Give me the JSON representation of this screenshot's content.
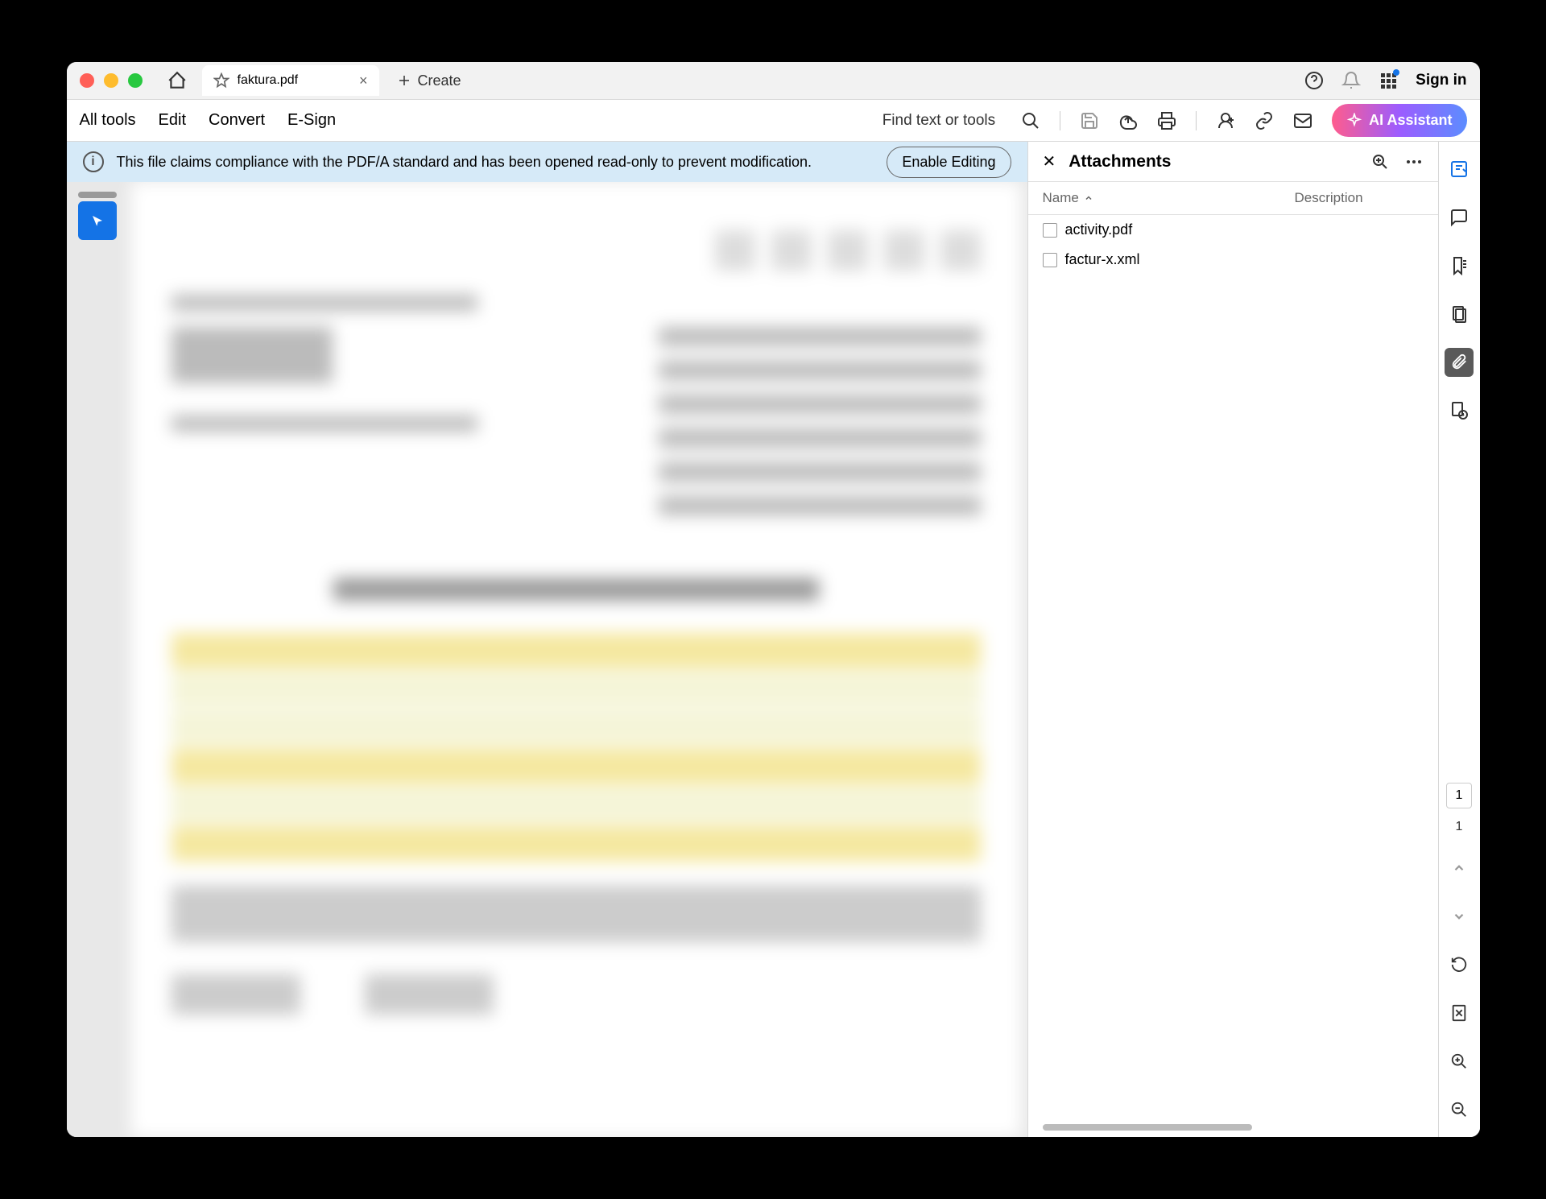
{
  "window": {
    "filename": "faktura.pdf"
  },
  "tabs": {
    "create_label": "Create",
    "signin_label": "Sign in"
  },
  "toolbar": {
    "all_tools": "All tools",
    "edit": "Edit",
    "convert": "Convert",
    "esign": "E-Sign",
    "find": "Find text or tools",
    "ai_label": "AI Assistant"
  },
  "info_bar": {
    "message": "This file claims compliance with the PDF/A standard and has been opened read-only to prevent modification.",
    "enable_label": "Enable Editing"
  },
  "panel": {
    "title": "Attachments",
    "col_name": "Name",
    "col_desc": "Description",
    "items": [
      {
        "name": "activity.pdf"
      },
      {
        "name": "factur-x.xml"
      }
    ]
  },
  "page_nav": {
    "current": "1",
    "total": "1"
  }
}
